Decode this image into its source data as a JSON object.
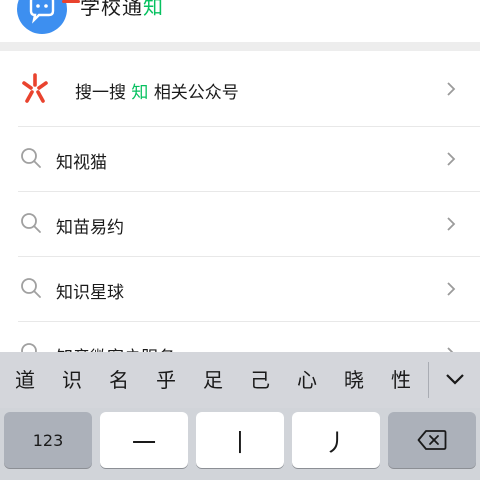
{
  "top_result": {
    "title_prefix": "学校通",
    "title_highlight": "知",
    "highlight_color": "#07c160",
    "icon": "chat-bubble-icon"
  },
  "official_accounts_row": {
    "prefix": "搜一搜",
    "highlight": "知",
    "suffix": "相关公众号",
    "icon": "sou-yi-sou-icon"
  },
  "suggestions": [
    {
      "label": "知视猫"
    },
    {
      "label": "知苗易约"
    },
    {
      "label": "知识星球"
    },
    {
      "label": "知音微客户服务"
    }
  ],
  "keyboard": {
    "candidates": [
      "道",
      "识",
      "名",
      "乎",
      "足",
      "己",
      "心",
      "晓",
      "性"
    ],
    "keys": {
      "numbers": "123",
      "stroke_horizontal": "一",
      "stroke_vertical": "丨",
      "stroke_left_fall": "丿"
    }
  }
}
